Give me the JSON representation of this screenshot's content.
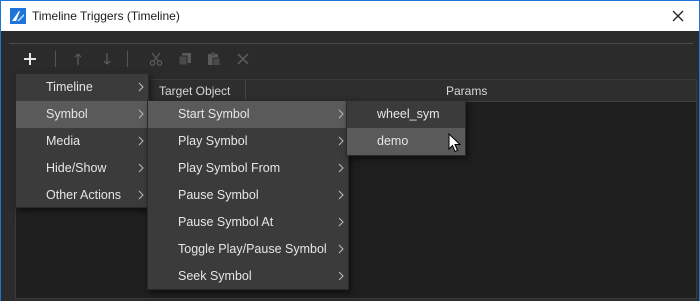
{
  "window": {
    "title": "Timeline Triggers (Timeline)",
    "accent": "#1e74d8"
  },
  "toolbar": {
    "buttons": [
      {
        "icon": "plus-icon",
        "enabled": true
      },
      {
        "icon": "arrow-up-icon",
        "enabled": false
      },
      {
        "icon": "arrow-down-icon",
        "enabled": false
      },
      {
        "icon": "cut-icon",
        "enabled": false
      },
      {
        "icon": "copy-icon",
        "enabled": false
      },
      {
        "icon": "paste-icon",
        "enabled": false
      },
      {
        "icon": "delete-icon",
        "enabled": false
      }
    ]
  },
  "table": {
    "columns": [
      "Target Object",
      "Params"
    ]
  },
  "menu_main": {
    "items": [
      {
        "label": "Timeline",
        "selected": false
      },
      {
        "label": "Symbol",
        "selected": true
      },
      {
        "label": "Media",
        "selected": false
      },
      {
        "label": "Hide/Show",
        "selected": false
      },
      {
        "label": "Other Actions",
        "selected": false
      }
    ]
  },
  "menu_symbol": {
    "items": [
      {
        "label": "Start Symbol",
        "selected": true
      },
      {
        "label": "Play Symbol",
        "selected": false
      },
      {
        "label": "Play Symbol From",
        "selected": false
      },
      {
        "label": "Pause Symbol",
        "selected": false
      },
      {
        "label": "Pause Symbol At",
        "selected": false
      },
      {
        "label": "Toggle Play/Pause Symbol",
        "selected": false
      },
      {
        "label": "Seek Symbol",
        "selected": false
      }
    ]
  },
  "menu_targets": {
    "items": [
      {
        "label": "wheel_sym",
        "selected": false
      },
      {
        "label": "demo",
        "selected": true
      }
    ]
  },
  "colors": {
    "panel_bg": "#2b2b2b",
    "menu_bg": "#3b3b3b",
    "menu_selected": "#5a5a5a"
  }
}
